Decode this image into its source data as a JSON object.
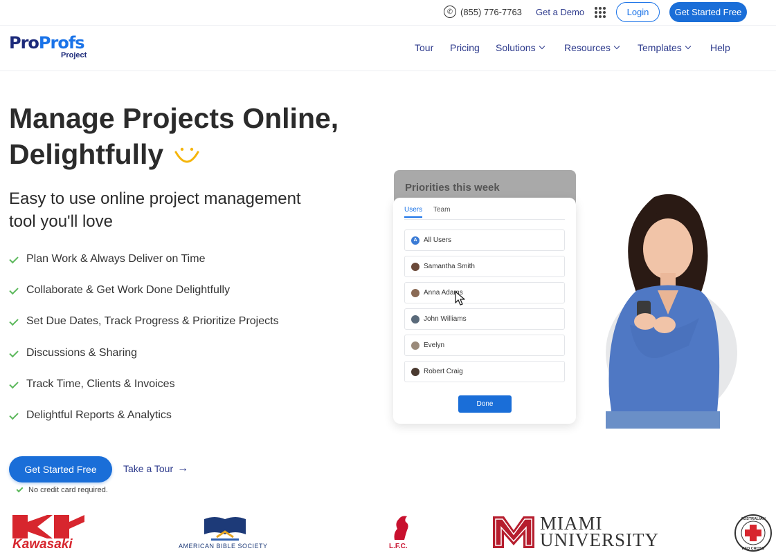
{
  "topbar": {
    "phone": "(855) 776-7763",
    "demo_label": "Get a Demo",
    "login_label": "Login",
    "cta_label": "Get Started Free"
  },
  "brand": {
    "name_part1": "Pro",
    "name_part2": "Profs",
    "product": "Project",
    "colors": {
      "navy": "#1c2a7a",
      "blue": "#1a73e8"
    }
  },
  "nav": {
    "items": [
      {
        "label": "Tour",
        "dropdown": false
      },
      {
        "label": "Pricing",
        "dropdown": false
      },
      {
        "label": "Solutions",
        "dropdown": true
      },
      {
        "label": "Resources",
        "dropdown": true
      },
      {
        "label": "Templates",
        "dropdown": true
      },
      {
        "label": "Help",
        "dropdown": false
      }
    ]
  },
  "hero": {
    "title_line1": "Manage Projects Online,",
    "title_line2": "Delightfully",
    "subtitle": "Easy to use online project management tool you'll love",
    "features": [
      "Plan Work & Always Deliver on Time",
      "Collaborate & Get Work Done Delightfully",
      "Set Due Dates, Track Progress & Prioritize Projects",
      "Discussions & Sharing",
      "Track Time, Clients & Invoices",
      "Delightful Reports & Analytics"
    ],
    "cta_label": "Get Started Free",
    "tour_label": "Take a Tour",
    "note": "No credit card required."
  },
  "card": {
    "title": "Priorities this week",
    "tabs": [
      "Users",
      "Team"
    ],
    "users": [
      {
        "name": "All Users",
        "avatar": "A"
      },
      {
        "name": "Samantha Smith"
      },
      {
        "name": "Anna Adams"
      },
      {
        "name": "John Williams"
      },
      {
        "name": "Evelyn"
      },
      {
        "name": "Robert Craig"
      }
    ],
    "done_label": "Done"
  },
  "logos": {
    "kawasaki": "Kawasaki",
    "bible_society": "AMERICAN BIBLE SOCIETY",
    "lfc": "L.F.C.",
    "miami_line1": "MIAMI",
    "miami_line2": "UNIVERSITY",
    "red_cross_top": "AUSTRALIAN",
    "red_cross_bottom": "RED CROSS"
  },
  "icons": [
    "phone-icon",
    "apps-grid-icon",
    "chevron-down-icon",
    "smile-icon",
    "check-icon",
    "arrow-right-icon",
    "cursor-icon"
  ]
}
